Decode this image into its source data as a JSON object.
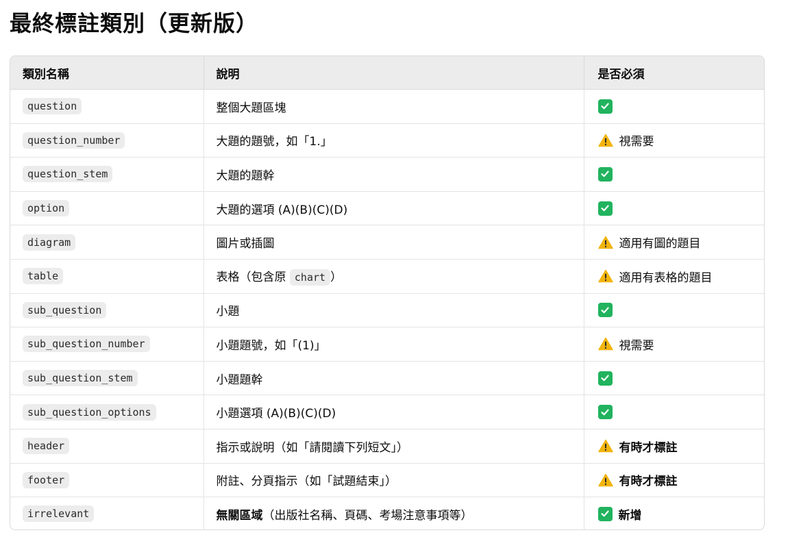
{
  "title": "最終標註類別（更新版）",
  "colors": {
    "check": "#21b35e",
    "warning": "#f2b40f"
  },
  "table": {
    "headers": [
      "類別名稱",
      "說明",
      "是否必須"
    ],
    "rows": [
      {
        "code": "question",
        "desc": "整個大題區塊",
        "icon": "check-icon",
        "req": ""
      },
      {
        "code": "question_number",
        "desc": "大題的題號，如「1.」",
        "icon": "warning-icon",
        "req": "視需要"
      },
      {
        "code": "question_stem",
        "desc": "大題的題幹",
        "icon": "check-icon",
        "req": ""
      },
      {
        "code": "option",
        "desc": "大題的選項 (A)(B)(C)(D)",
        "icon": "check-icon",
        "req": ""
      },
      {
        "code": "diagram",
        "desc": "圖片或插圖",
        "icon": "warning-icon",
        "req": "適用有圖的題目"
      },
      {
        "code": "table",
        "desc_before": "表格（包含原 ",
        "desc_code": "chart",
        "desc_after": "）",
        "icon": "warning-icon",
        "req": "適用有表格的題目"
      },
      {
        "code": "sub_question",
        "desc": "小題",
        "icon": "check-icon",
        "req": ""
      },
      {
        "code": "sub_question_number",
        "desc": "小題題號，如「(1)」",
        "icon": "warning-icon",
        "req": "視需要"
      },
      {
        "code": "sub_question_stem",
        "desc": "小題題幹",
        "icon": "check-icon",
        "req": ""
      },
      {
        "code": "sub_question_options",
        "desc": "小題選項 (A)(B)(C)(D)",
        "icon": "check-icon",
        "req": ""
      },
      {
        "code": "header",
        "desc": "指示或說明（如「請閱讀下列短文」）",
        "icon": "warning-icon",
        "req": "有時才標註"
      },
      {
        "code": "footer",
        "desc": "附註、分頁指示（如「試題結束」）",
        "icon": "warning-icon",
        "req": "有時才標註"
      },
      {
        "code": "irrelevant",
        "desc_bold": "無關區域",
        "desc_rest": "（出版社名稱、頁碼、考場注意事項等）",
        "icon": "check-icon",
        "req": "新增"
      }
    ]
  }
}
